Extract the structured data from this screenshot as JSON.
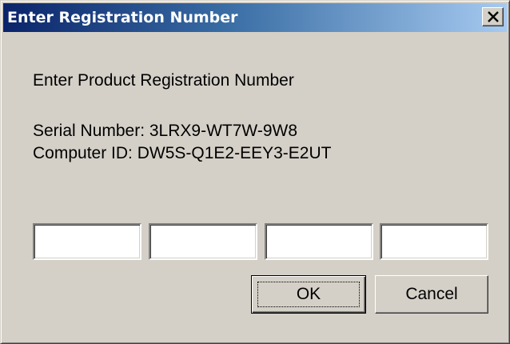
{
  "window": {
    "title": "Enter Registration Number",
    "close_icon": "close-x-icon"
  },
  "content": {
    "prompt": "Enter Product Registration Number",
    "serial_line": "Serial Number: 3LRX9-WT7W-9W8",
    "computer_id_line": "Computer ID: DW5S-Q1E2-EEY3-E2UT"
  },
  "fields": [
    {
      "value": ""
    },
    {
      "value": ""
    },
    {
      "value": ""
    },
    {
      "value": ""
    }
  ],
  "buttons": {
    "ok_label": "OK",
    "cancel_label": "Cancel"
  },
  "colors": {
    "titlebar_start": "#0a246a",
    "titlebar_end": "#a6caf0",
    "face": "#d4d0c8"
  }
}
